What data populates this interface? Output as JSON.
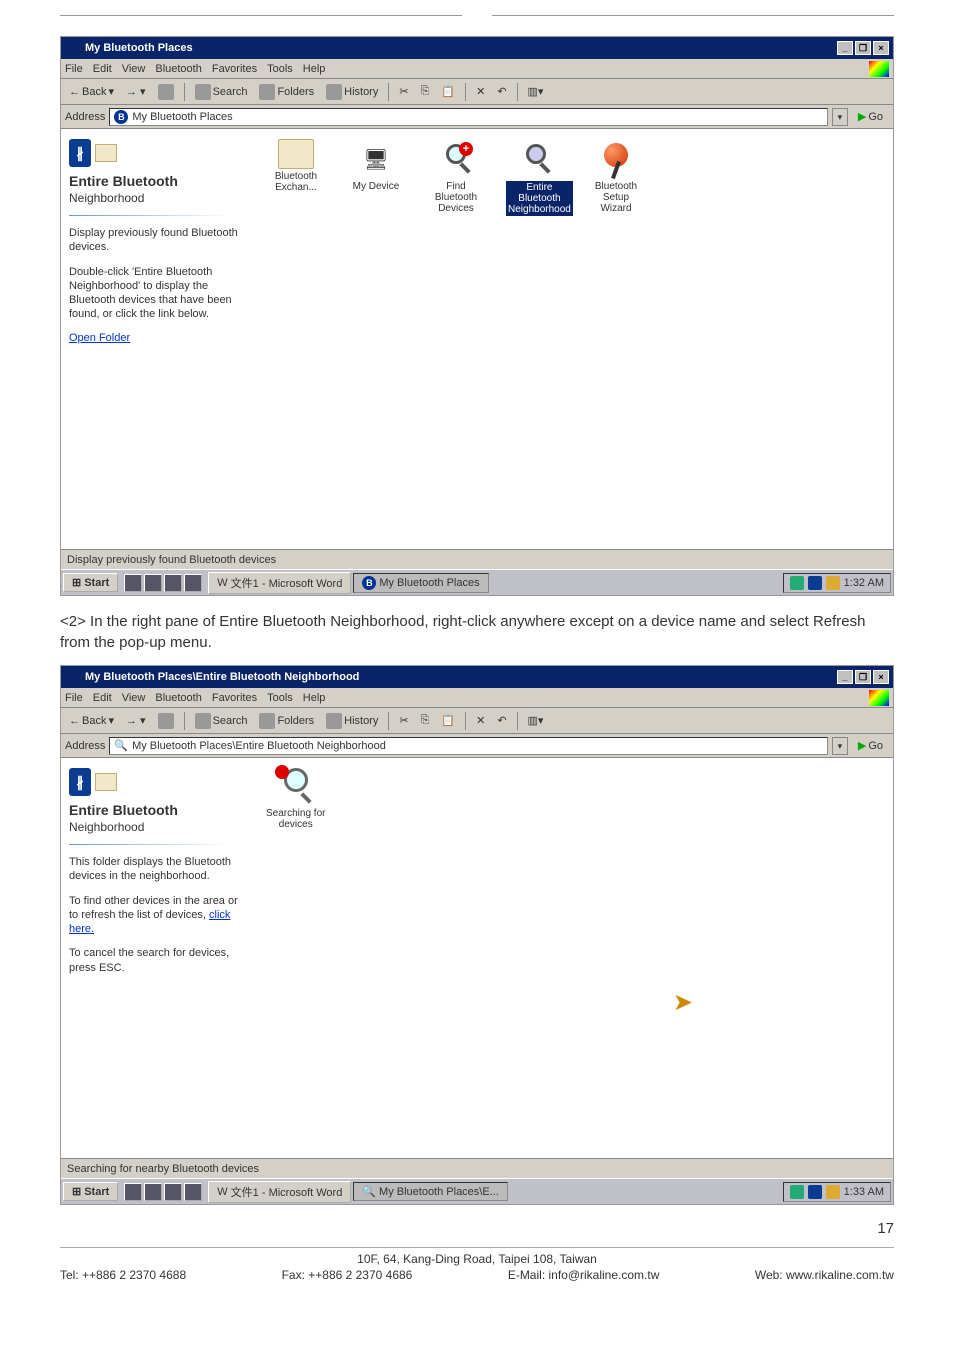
{
  "window1": {
    "title": "My Bluetooth Places",
    "menubar": [
      "File",
      "Edit",
      "View",
      "Bluetooth",
      "Favorites",
      "Tools",
      "Help"
    ],
    "toolbar": {
      "back": "Back",
      "search": "Search",
      "folders": "Folders",
      "history": "History"
    },
    "addressbar": {
      "label": "Address",
      "value": "My Bluetooth Places",
      "go": "Go"
    },
    "leftpane": {
      "title": "Entire Bluetooth",
      "subtitle": "Neighborhood",
      "para1": "Display previously found Bluetooth devices.",
      "para2_a": "Double-click 'Entire Bluetooth Neighborhood' to display the Bluetooth devices that have been found, or click the link below.",
      "link": "Open Folder"
    },
    "devices": [
      {
        "id": "bt-exchange",
        "label": "Bluetooth Exchan..."
      },
      {
        "id": "my-device",
        "label": "My Device"
      },
      {
        "id": "find-bt",
        "label": "Find Bluetooth Devices"
      },
      {
        "id": "entire-bt",
        "label_a": "Entire",
        "label_b": "Bluetooth",
        "label_c": "Neighborhood",
        "selected": true
      },
      {
        "id": "bt-wizard",
        "label_a": "Bluetooth",
        "label_b": "Setup Wizard"
      }
    ],
    "status": "Display previously found Bluetooth devices",
    "taskbar": {
      "start": "Start",
      "t1": "文件1 - Microsoft Word",
      "t2": "My Bluetooth Places",
      "time": "1:32 AM"
    }
  },
  "body_text": "<2> In the right pane of Entire Bluetooth Neighborhood, right-click anywhere except on a device name and select Refresh from the pop-up menu.",
  "window2": {
    "title": "My Bluetooth Places\\Entire Bluetooth Neighborhood",
    "menubar": [
      "File",
      "Edit",
      "View",
      "Bluetooth",
      "Favorites",
      "Tools",
      "Help"
    ],
    "toolbar": {
      "back": "Back",
      "search": "Search",
      "folders": "Folders",
      "history": "History"
    },
    "addressbar": {
      "label": "Address",
      "value": "My Bluetooth Places\\Entire Bluetooth Neighborhood",
      "go": "Go"
    },
    "leftpane": {
      "title": "Entire Bluetooth",
      "subtitle": "Neighborhood",
      "para1": "This folder displays the Bluetooth devices in the neighborhood.",
      "para2": "To find other devices in the area or to refresh the list of devices,",
      "link2": "click here.",
      "para3": "To cancel the search for devices, press ESC."
    },
    "center": {
      "label_a": "Searching for",
      "label_b": "devices"
    },
    "status": "Searching for nearby Bluetooth devices",
    "taskbar": {
      "start": "Start",
      "t1": "文件1 - Microsoft Word",
      "t2": "My Bluetooth Places\\E...",
      "time": "1:33 AM"
    }
  },
  "footer": {
    "line1": "10F, 64, Kang-Ding Road, Taipei 108, Taiwan",
    "tel": "Tel: ++886 2 2370 4688",
    "fax": "Fax: ++886 2 2370 4686",
    "email": "E-Mail: info@rikaline.com.tw",
    "web": "Web: www.rikaline.com.tw",
    "pagenum": "17"
  }
}
